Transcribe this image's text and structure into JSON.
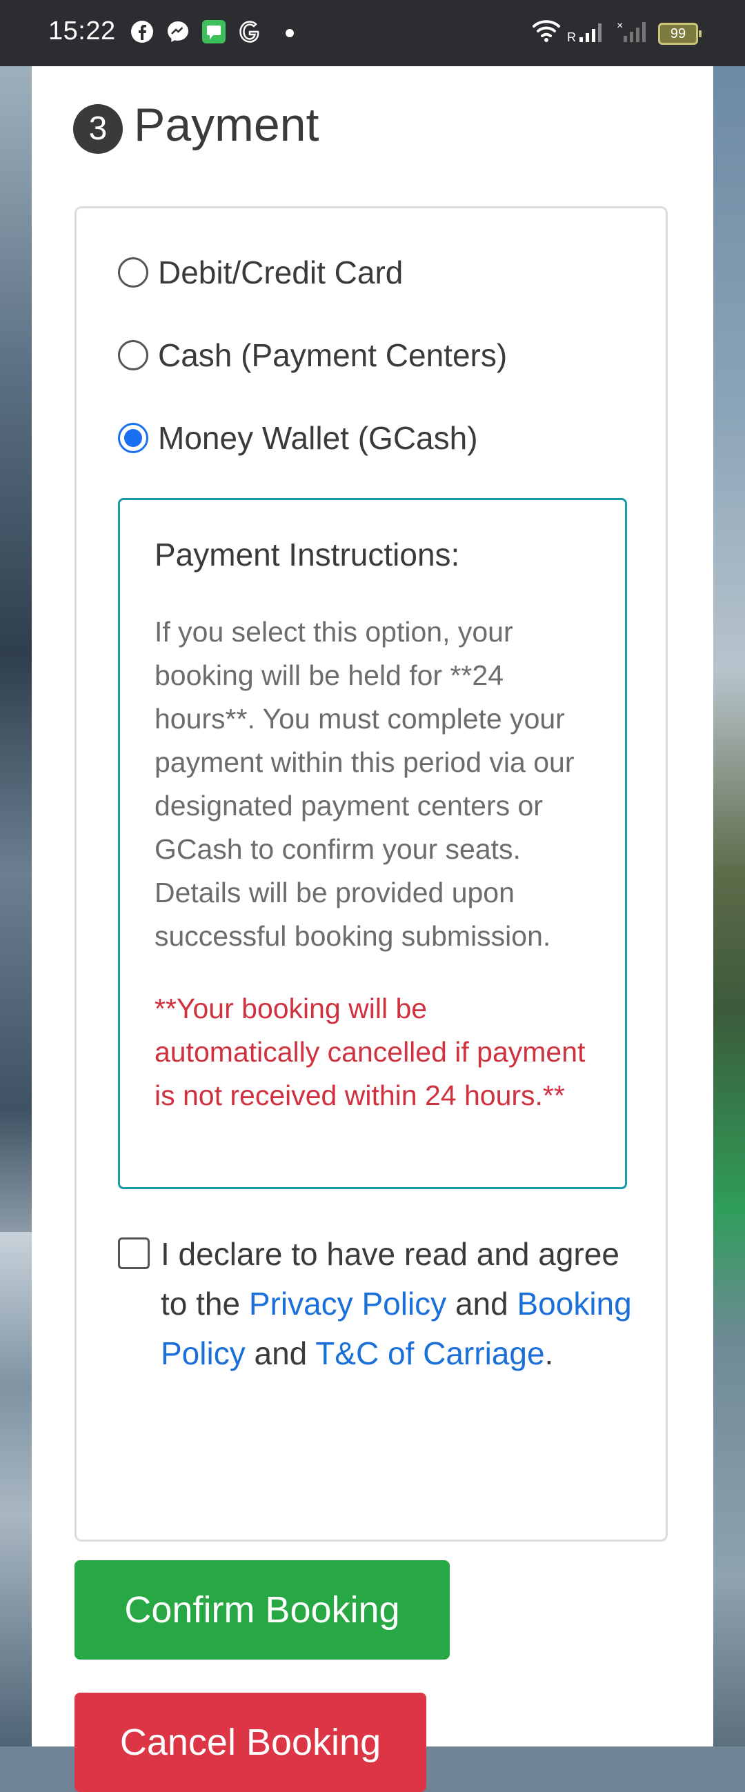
{
  "status_bar": {
    "time": "15:22",
    "battery": "99",
    "notification_icons": [
      "facebook-icon",
      "messenger-icon",
      "chat-icon",
      "g-icon"
    ],
    "signal": "R"
  },
  "section": {
    "step": "3",
    "title": "Payment"
  },
  "payment_options": [
    {
      "label": "Debit/Credit Card",
      "selected": false
    },
    {
      "label": "Cash (Payment Centers)",
      "selected": false
    },
    {
      "label": "Money Wallet (GCash)",
      "selected": true
    }
  ],
  "instructions": {
    "title": "Payment Instructions:",
    "body": "If you select this option, your booking will be held for **24 hours**. You must complete your payment within this period via our designated payment centers or GCash to confirm your seats. Details will be provided upon successful booking submission.",
    "warning": "**Your booking will be automatically cancelled if payment is not received within 24 hours.**"
  },
  "agreement": {
    "text_1": "I declare to have read and agree to the ",
    "link_privacy": "Privacy Policy",
    "text_2": " and ",
    "link_booking": "Booking Policy",
    "text_3": " and ",
    "link_tc": "T&C of Carriage",
    "text_4": "."
  },
  "buttons": {
    "confirm": "Confirm Booking",
    "cancel": "Cancel Booking"
  },
  "colors": {
    "accent": "#1a6ff0",
    "confirm": "#28a745",
    "cancel": "#dc3545",
    "warning": "#d0313f",
    "instructions_border": "#1b9aa8"
  }
}
